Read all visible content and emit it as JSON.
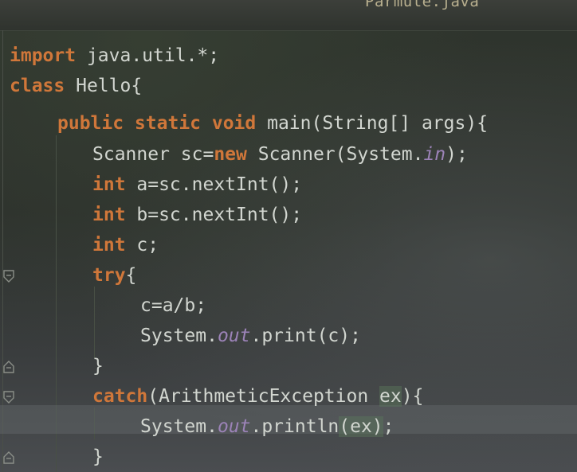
{
  "editor": {
    "tab_title": "Parmute.java",
    "lines": [
      {
        "indent": 0,
        "tokens": [
          [
            "kw",
            "import"
          ],
          [
            "pl",
            " java.util.*;"
          ]
        ]
      },
      {
        "indent": 0,
        "tokens": [
          [
            "kw",
            "class"
          ],
          [
            "pl",
            " Hello{"
          ]
        ]
      },
      {
        "indent": 1,
        "tokens": [
          [
            "kw",
            "public static void"
          ],
          [
            "pl",
            " main(String[] args){"
          ]
        ]
      },
      {
        "indent": 2,
        "tokens": [
          [
            "pl",
            "Scanner sc="
          ],
          [
            "kw",
            "new"
          ],
          [
            "pl",
            " Scanner(System."
          ],
          [
            "it",
            "in"
          ],
          [
            "pl",
            ");"
          ]
        ]
      },
      {
        "indent": 2,
        "tokens": [
          [
            "kw",
            "int"
          ],
          [
            "pl",
            " a=sc.nextInt();"
          ]
        ]
      },
      {
        "indent": 2,
        "tokens": [
          [
            "kw",
            "int"
          ],
          [
            "pl",
            " b=sc.nextInt();"
          ]
        ]
      },
      {
        "indent": 2,
        "tokens": [
          [
            "kw",
            "int"
          ],
          [
            "pl",
            " c;"
          ]
        ]
      },
      {
        "indent": 2,
        "tokens": [
          [
            "kw",
            "try"
          ],
          [
            "pl",
            "{"
          ]
        ]
      },
      {
        "indent": 3,
        "tokens": [
          [
            "pl",
            "c=a/b;"
          ]
        ]
      },
      {
        "indent": 3,
        "tokens": [
          [
            "pl",
            "System."
          ],
          [
            "it",
            "out"
          ],
          [
            "pl",
            ".print(c);"
          ]
        ]
      },
      {
        "indent": 2,
        "tokens": [
          [
            "pl",
            "}"
          ]
        ]
      },
      {
        "indent": 2,
        "tokens": [
          [
            "kw",
            "catch"
          ],
          [
            "pl",
            "(ArithmeticException "
          ],
          [
            "hl",
            "ex"
          ],
          [
            "pl",
            "){"
          ]
        ]
      },
      {
        "indent": 3,
        "tokens": [
          [
            "pl",
            "System."
          ],
          [
            "it",
            "out"
          ],
          [
            "pl",
            ".println"
          ],
          [
            "hl",
            "(ex)"
          ],
          [
            "pl",
            ";"
          ]
        ]
      },
      {
        "indent": 2,
        "tokens": [
          [
            "pl",
            "}"
          ]
        ]
      }
    ]
  },
  "gutter": {
    "fold_markers": [
      {
        "line": 7,
        "kind": "fold-open-icon"
      },
      {
        "line": 10,
        "kind": "fold-close-icon"
      },
      {
        "line": 11,
        "kind": "fold-open-icon"
      },
      {
        "line": 13,
        "kind": "fold-close-icon"
      }
    ]
  },
  "colors": {
    "keyword": "#d0773a",
    "static_field": "#9c83b8",
    "plain_text": "#d2d6d0"
  }
}
